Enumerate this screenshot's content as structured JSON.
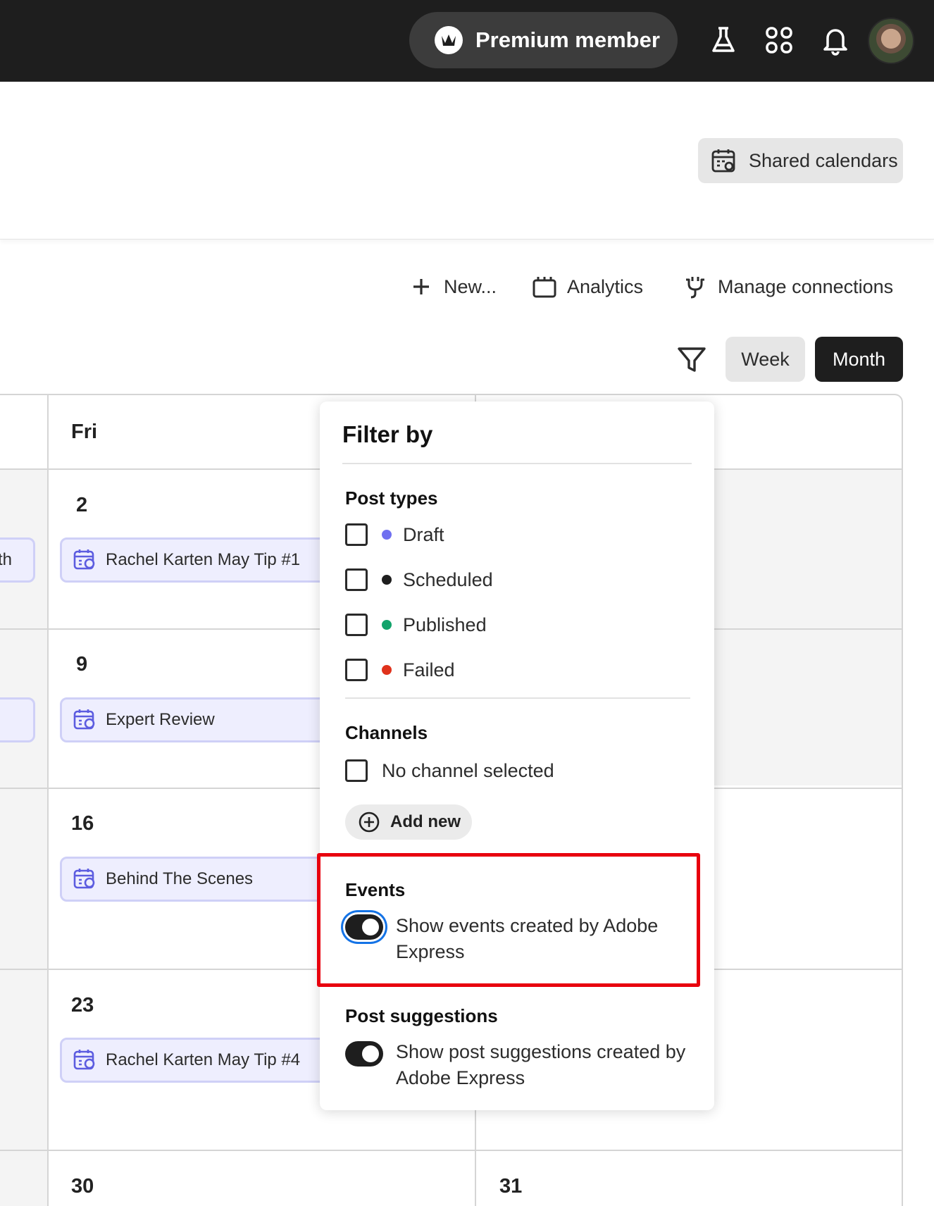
{
  "topbar": {
    "premium_label": "Premium member",
    "icons": [
      "crown-icon",
      "beaker-icon",
      "apps-grid-icon",
      "bell-icon"
    ]
  },
  "header": {
    "shared_calendars_label": "Shared calendars"
  },
  "toolbar": {
    "new_label": "New...",
    "analytics_label": "Analytics",
    "manage_connections_label": "Manage connections",
    "week_label": "Week",
    "month_label": "Month"
  },
  "calendar": {
    "day_header": "Fri",
    "left_cut_text": "th",
    "weeks": [
      {
        "day": "2",
        "event": "Rachel Karten May Tip #1"
      },
      {
        "day": "9",
        "event": "Expert Review"
      },
      {
        "day": "16",
        "event": "Behind The Scenes"
      },
      {
        "day": "23",
        "event": "Rachel Karten May Tip #4"
      }
    ],
    "last_row": {
      "day_fri": "30",
      "day_sat": "31"
    }
  },
  "filter": {
    "title": "Filter by",
    "post_types_title": "Post types",
    "post_types": [
      {
        "label": "Draft",
        "color": "#7070f0"
      },
      {
        "label": "Scheduled",
        "color": "#1e1e1e"
      },
      {
        "label": "Published",
        "color": "#12a36b"
      },
      {
        "label": "Failed",
        "color": "#e0321c"
      }
    ],
    "channels_title": "Channels",
    "channels_none": "No channel selected",
    "add_new_label": "Add new",
    "events_title": "Events",
    "events_toggle_label": "Show events created by Adobe Express",
    "events_toggle_on": true,
    "suggestions_title": "Post suggestions",
    "suggestions_toggle_label": "Show post suggestions created by Adobe Express",
    "suggestions_toggle_on": true
  },
  "colors": {
    "topbar_bg": "#1e1e1e",
    "highlight": "#e8000e",
    "event_pill_bg": "#eeeefe",
    "event_pill_border": "#cfd0f7",
    "focus_ring": "#1473e6"
  }
}
